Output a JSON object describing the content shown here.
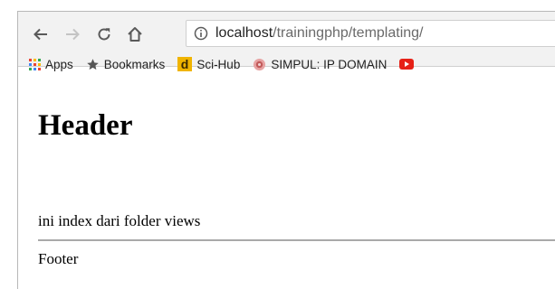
{
  "browser": {
    "url_host": "localhost",
    "url_path": "/trainingphp/templating/",
    "bookmarks": [
      {
        "label": "Apps",
        "icon": "apps-grid-icon"
      },
      {
        "label": "Bookmarks",
        "icon": "star-icon"
      },
      {
        "label": "Sci-Hub",
        "icon": "sci-hub-d-icon"
      },
      {
        "label": "SIMPUL: IP DOMAIN",
        "icon": "simpul-site-icon"
      }
    ]
  },
  "page": {
    "header": "Header",
    "content": "ini index dari folder views",
    "footer": "Footer"
  }
}
